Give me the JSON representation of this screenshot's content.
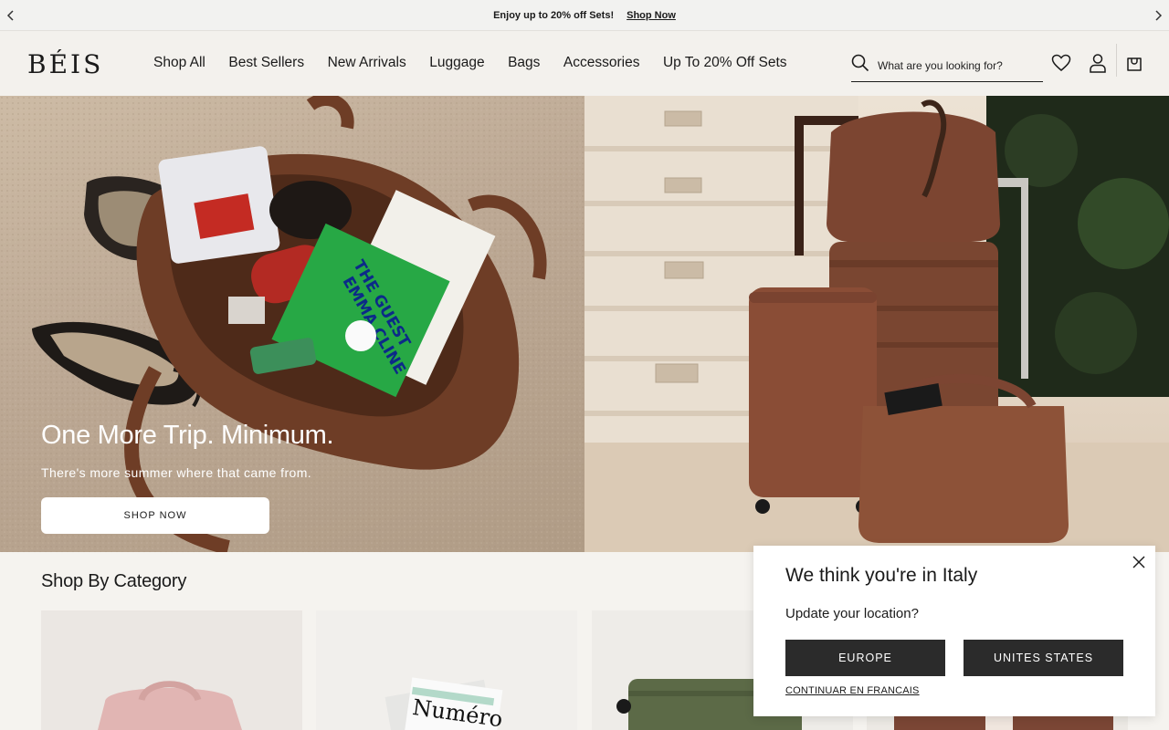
{
  "announcement": {
    "message": "Enjoy up to 20% off Sets!",
    "link": "Shop Now",
    "prev_icon": "chevron-left-icon",
    "next_icon": "chevron-right-icon"
  },
  "header": {
    "logo": "BÉIS",
    "nav": [
      "Shop All",
      "Best Sellers",
      "New Arrivals",
      "Luggage",
      "Bags",
      "Accessories",
      "Up To 20% Off Sets"
    ],
    "search_placeholder": "What are you looking for?",
    "icons": [
      "search-icon",
      "heart-icon",
      "account-icon",
      "cart-icon"
    ]
  },
  "hero": {
    "title": "One More Trip. Minimum.",
    "subtitle": "There's more summer where that came from.",
    "button": "SHOP NOW",
    "book_text": "THE GUEST EMMA CLINE"
  },
  "category": {
    "title": "Shop By Category"
  },
  "popup": {
    "title": "We think you're in Italy",
    "subtitle": "Update your location?",
    "button_europe": "EUROPE",
    "button_us": "UNITES STATES",
    "language_link": "CONTINUAR EN FRANCAIS",
    "close_icon": "close-icon"
  },
  "colors": {
    "brown": "#6e3d26",
    "dark_button": "#2b2b2b",
    "green_book": "#27a845"
  }
}
